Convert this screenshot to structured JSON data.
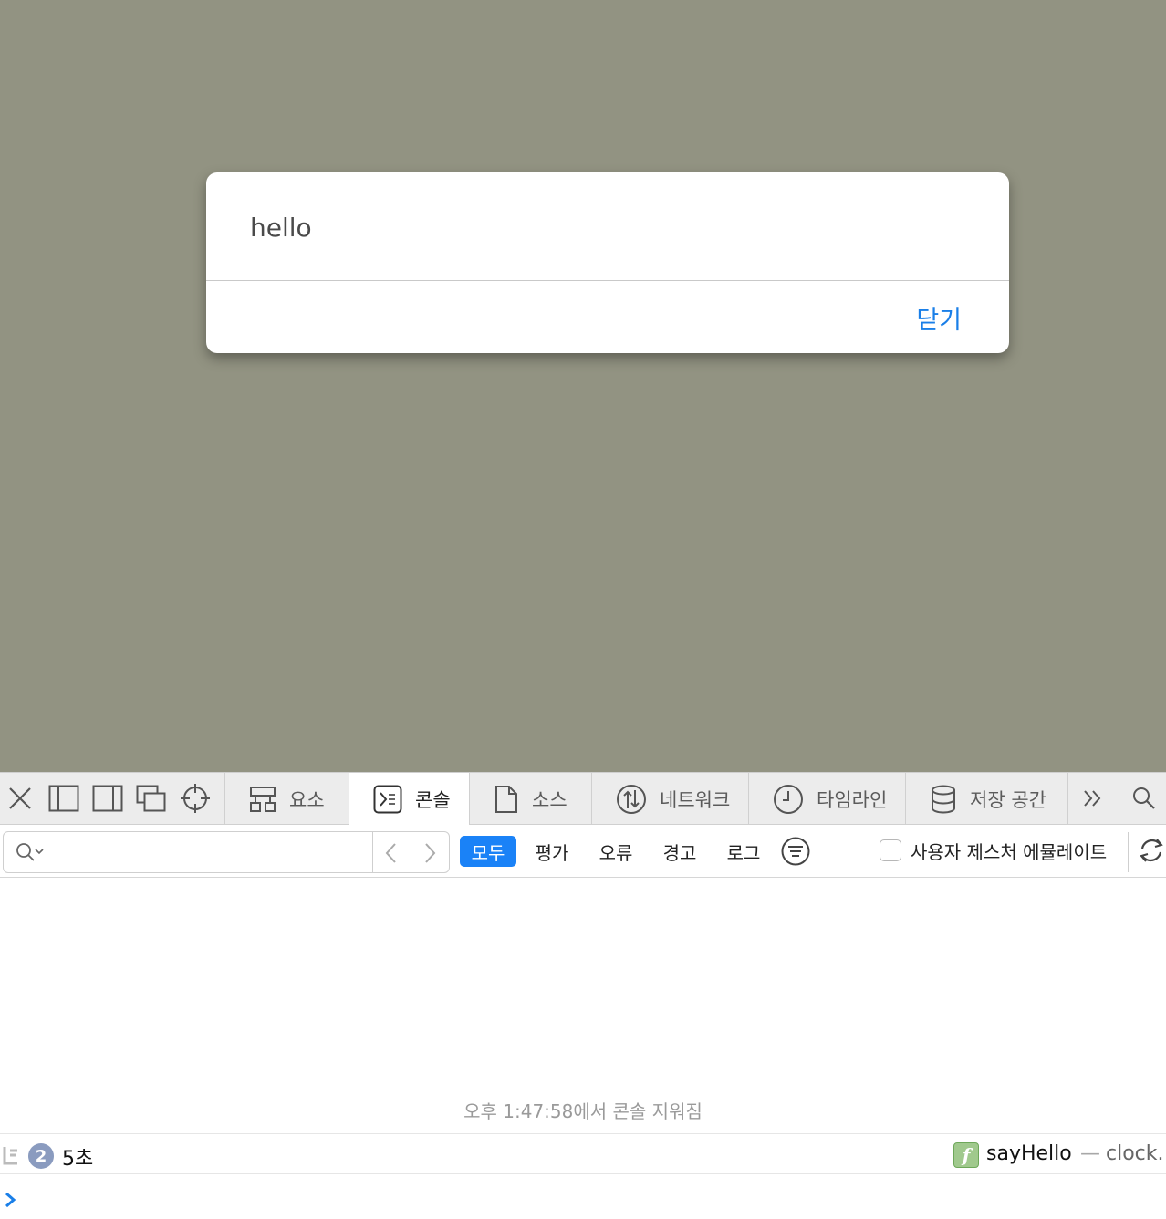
{
  "alert": {
    "message": "hello",
    "close_label": "닫기"
  },
  "devtools": {
    "tabs": [
      {
        "label": "요소",
        "icon": "elements-icon"
      },
      {
        "label": "콘솔",
        "icon": "console-icon",
        "active": true
      },
      {
        "label": "소스",
        "icon": "document-icon"
      },
      {
        "label": "네트워크",
        "icon": "network-icon"
      },
      {
        "label": "타임라인",
        "icon": "clock-icon"
      },
      {
        "label": "저장 공간",
        "icon": "database-icon"
      }
    ],
    "filters": {
      "all": "모두",
      "evaluations": "평가",
      "errors": "오류",
      "warnings": "경고",
      "logs": "로그"
    },
    "search": {
      "value": "",
      "placeholder": ""
    },
    "emulate_gesture_label": "사용자 제스처 에뮬레이트"
  },
  "console": {
    "cleared_message": "오후 1:47:58에서 콘솔 지워짐",
    "entry": {
      "count": "2",
      "text": "5초",
      "function_name": "sayHello",
      "separator": "—",
      "source": "clock."
    }
  },
  "colors": {
    "accent": "#1a82f7",
    "page_background": "#929382"
  }
}
